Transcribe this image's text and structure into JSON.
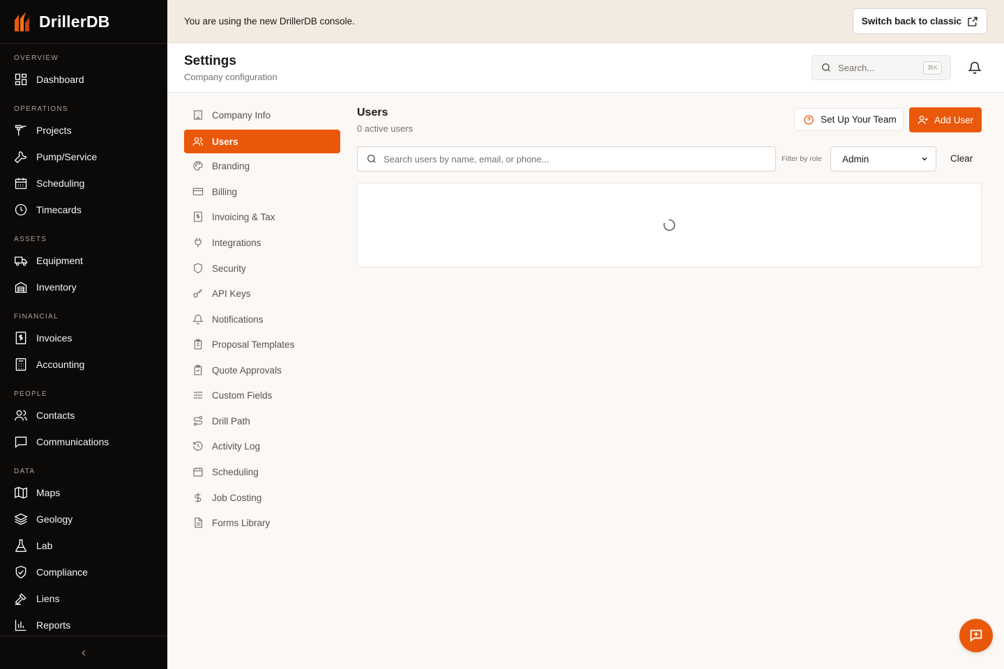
{
  "app": {
    "name": "DrillerDB",
    "brand_color": "#ea580c"
  },
  "sidebar": {
    "sections": [
      {
        "label": "OVERVIEW",
        "items": [
          {
            "label": "Dashboard",
            "icon": "grid-icon"
          }
        ]
      },
      {
        "label": "OPERATIONS",
        "items": [
          {
            "label": "Projects",
            "icon": "drill-icon"
          },
          {
            "label": "Pump/Service",
            "icon": "wrench-icon"
          },
          {
            "label": "Scheduling",
            "icon": "calendar-icon"
          },
          {
            "label": "Timecards",
            "icon": "clock-icon"
          }
        ]
      },
      {
        "label": "ASSETS",
        "items": [
          {
            "label": "Equipment",
            "icon": "truck-icon"
          },
          {
            "label": "Inventory",
            "icon": "warehouse-icon"
          }
        ]
      },
      {
        "label": "FINANCIAL",
        "items": [
          {
            "label": "Invoices",
            "icon": "invoice-icon"
          },
          {
            "label": "Accounting",
            "icon": "calculator-icon"
          }
        ]
      },
      {
        "label": "PEOPLE",
        "items": [
          {
            "label": "Contacts",
            "icon": "users-icon"
          },
          {
            "label": "Communications",
            "icon": "message-icon"
          }
        ]
      },
      {
        "label": "DATA",
        "items": [
          {
            "label": "Maps",
            "icon": "map-icon"
          },
          {
            "label": "Geology",
            "icon": "layers-icon"
          },
          {
            "label": "Lab",
            "icon": "flask-icon"
          },
          {
            "label": "Compliance",
            "icon": "shield-check-icon"
          },
          {
            "label": "Liens",
            "icon": "gavel-icon"
          },
          {
            "label": "Reports",
            "icon": "bar-chart-icon"
          }
        ]
      }
    ]
  },
  "banner": {
    "text": "You are using the new DrillerDB console.",
    "button_label": "Switch back to classic"
  },
  "header": {
    "title": "Settings",
    "subtitle": "Company configuration",
    "search_placeholder": "Search...",
    "shortcut": "⌘K"
  },
  "settings_menu": {
    "items": [
      {
        "label": "Company Info",
        "icon": "building-icon"
      },
      {
        "label": "Users",
        "icon": "users-icon",
        "active": true
      },
      {
        "label": "Branding",
        "icon": "palette-icon"
      },
      {
        "label": "Billing",
        "icon": "credit-card-icon"
      },
      {
        "label": "Invoicing & Tax",
        "icon": "receipt-icon"
      },
      {
        "label": "Integrations",
        "icon": "plug-icon"
      },
      {
        "label": "Security",
        "icon": "shield-icon"
      },
      {
        "label": "API Keys",
        "icon": "key-icon"
      },
      {
        "label": "Notifications",
        "icon": "bell-icon"
      },
      {
        "label": "Proposal Templates",
        "icon": "clipboard-icon"
      },
      {
        "label": "Quote Approvals",
        "icon": "clipboard-check-icon"
      },
      {
        "label": "Custom Fields",
        "icon": "sliders-icon"
      },
      {
        "label": "Drill Path",
        "icon": "route-icon"
      },
      {
        "label": "Activity Log",
        "icon": "history-icon"
      },
      {
        "label": "Scheduling",
        "icon": "calendar-icon"
      },
      {
        "label": "Job Costing",
        "icon": "dollar-icon"
      },
      {
        "label": "Forms Library",
        "icon": "file-icon"
      }
    ]
  },
  "users": {
    "title": "Users",
    "count_text": "0 active users",
    "setup_button": "Set Up Your Team",
    "add_button": "Add User",
    "search_placeholder": "Search users by name, email, or phone...",
    "filter_label": "Filter by role",
    "role_selected": "Admin",
    "clear_label": "Clear"
  }
}
